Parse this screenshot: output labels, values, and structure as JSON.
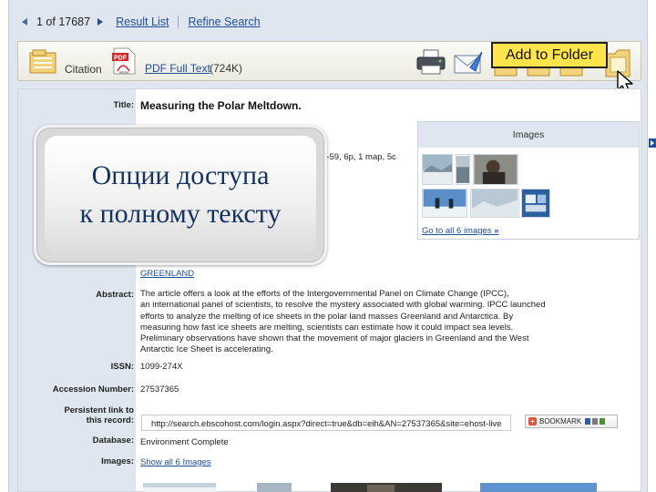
{
  "topnav": {
    "record_count": "1 of 17687",
    "result_list": "Result List",
    "refine_search": "Refine Search"
  },
  "toolbar": {
    "citation_label": "Citation",
    "pdf_icon_text": "PDF",
    "pdf_icon_sub": "Adobe",
    "pdf_link": "PDF Full Text",
    "pdf_size": "(724K)",
    "add_to_folder_tooltip": "Add to Folder"
  },
  "record": {
    "title_label": "Title:",
    "title": "Measuring the Polar Meltdown.",
    "source_fragment": "4-59, 6p, 1 map, 5c",
    "subject_link": "GREENLAND",
    "abstract_label": "Abstract:",
    "abstract_lines": [
      "The article offers a look at the efforts of the Intergovernmental Panel on Climate Change (IPCC),",
      "an international panel of scientists, to resolve the mystery associated with global warming. IPCC launched",
      "efforts to analyze the melting of ice sheets in the polar land masses Greenland and Antarctica. By",
      "measuring how fast ice sheets are melting, scientists can estimate how it could impact sea levels.",
      "Preliminary observations have shown that the movement of major glaciers in Greenland and the West",
      "Antarctic Ice Sheet is accelerating."
    ],
    "issn_label": "ISSN:",
    "issn": "1099-274X",
    "accession_label": "Accession Number:",
    "accession": "27537365",
    "persistent_label_1": "Persistent link to",
    "persistent_label_2": "this record:",
    "persistent_link": "http://search.ebscohost.com/login.aspx?direct=true&db=eih&AN=27537365&site=ehost-live",
    "bookmark_label": "BOOKMARK",
    "database_label": "Database:",
    "database": "Environment Complete",
    "images_label": "Images:",
    "show_images": "Show all 6 Images"
  },
  "images_box": {
    "heading": "Images",
    "goto": "Go to all 6 images",
    "goto_arrows": "»"
  },
  "callout": {
    "line1": "Опции доступа",
    "line2": "к полному тексту"
  },
  "colors": {
    "link": "#1f4e9a",
    "tooltip": "#ffe44b",
    "label_column": "#dfe6ef",
    "callout_text": "#13325f"
  }
}
